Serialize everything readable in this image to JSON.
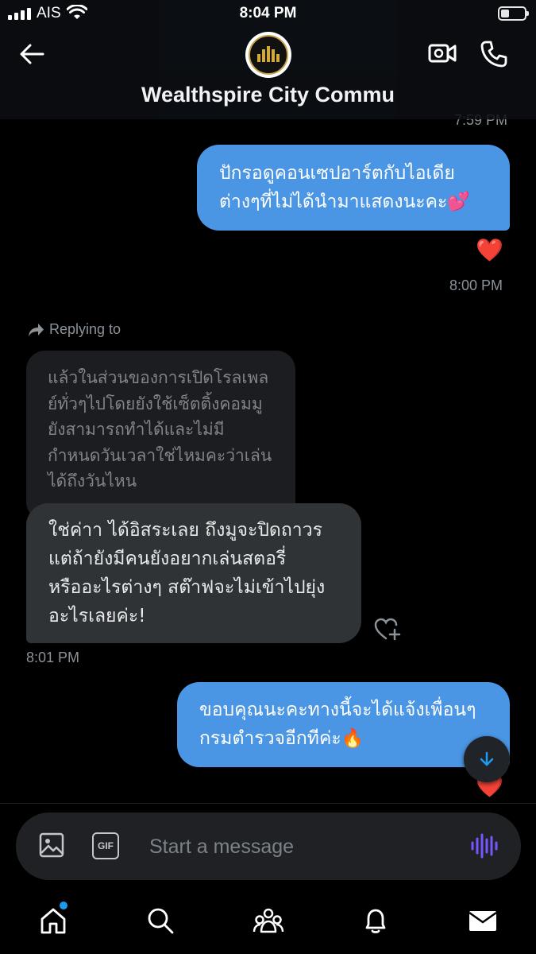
{
  "status_bar": {
    "carrier": "AIS",
    "time": "8:04 PM",
    "battery_level": 0.3
  },
  "header": {
    "title": "Wealthspire City Commu",
    "back_icon": "arrow-left-icon",
    "video_icon": "video-camera-icon",
    "call_icon": "phone-icon"
  },
  "messages": {
    "prev_timestamp": "7:59 PM",
    "sent_1": {
      "text": "ปักรอดูคอนเซปอาร์ตกับไอเดีย\nต่างๆที่ไม่ได้นำมาแสดงนะคะ💕",
      "reaction": "❤️",
      "timestamp": "8:00 PM"
    },
    "replying_to_label": "Replying to",
    "quoted_text": "แล้วในส่วนของการเปิดโรลเพล\nย์ทั่วๆไปโดยยังใช้เซ็ตติ้งคอมมู\nยังสามารถทำได้และไม่มี\nกำหนดวันเวลาใช่ไหมคะว่าเล่น\nได้ถึงวันไหน",
    "received_1": {
      "text": "ใช่ค่าา ได้อิสระเลย ถึงมูจะปิดถาวร\nแต่ถ้ายังมีคนยังอยากเล่นสตอรี่\nหรืออะไรต่างๆ สต๊าฟจะไม่เข้าไปยุ่ง\nอะไรเลยค่ะ!",
      "timestamp": "8:01 PM"
    },
    "sent_2": {
      "text": "ขอบคุณนะคะทางนี้จะได้แจ้งเพื่อนๆ\nกรมตำรวจอีกทีค่ะ🔥",
      "reaction": "❤️"
    }
  },
  "composer": {
    "placeholder": "Start a message",
    "gif_label": "GIF",
    "image_icon": "image-icon",
    "voice_icon": "voice-waveform-icon"
  },
  "nav": {
    "items": [
      "home-icon",
      "search-icon",
      "communities-icon",
      "notifications-icon",
      "messages-icon"
    ]
  },
  "colors": {
    "sent_bubble": "#4a96e5",
    "received_bubble": "#2f3336",
    "accent": "#1d9bf0",
    "voice": "#7856ff",
    "heart": "#e0245e"
  }
}
